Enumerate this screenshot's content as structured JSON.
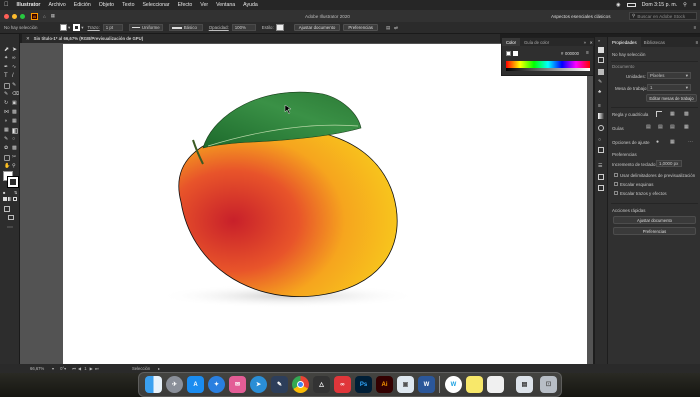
{
  "menubar": {
    "app_name": "Illustrator",
    "items": [
      "Archivo",
      "Edición",
      "Objeto",
      "Texto",
      "Seleccionar",
      "Efecto",
      "Ver",
      "Ventana",
      "Ayuda"
    ],
    "clock": "Dom 3:15 p. m."
  },
  "appbar": {
    "title": "Adobe Illustrator 2020",
    "workspace": "Aspectos esenciales clásicos",
    "search_placeholder": "Buscar en Adobe Stock"
  },
  "control": {
    "no_selection": "No hay selección",
    "stroke_label": "Trazo:",
    "stroke_value": "1 pt",
    "profile_label": "Uniforme",
    "brush_label": "Básico",
    "opacity_label": "Opacidad:",
    "opacity_value": "100%",
    "style_label": "Estilo:",
    "doc_setup_button": "Ajustar documento",
    "preferences_button": "Preferencias"
  },
  "document_tab": {
    "title": "Sin título-1* al 66,67% (RGB/Previsualización de GPU)"
  },
  "color_panel": {
    "tab_color": "Color",
    "tab_guide": "Guía de color",
    "hex_value": "000000"
  },
  "properties_panel": {
    "tab_properties": "Propiedades",
    "tab_libraries": "Bibliotecas",
    "no_selection": "No hay selección",
    "document_heading": "Documento",
    "units_label": "Unidades:",
    "units_value": "Píxeles",
    "artboard_label": "Mesa de trabajo:",
    "artboard_value": "1",
    "edit_artboards_button": "Editar mesas de trabajo",
    "ruler_grid_heading": "Regla y cuadrícula",
    "guides_heading": "Guías",
    "snap_options_heading": "Opciones de ajuste",
    "preferences_heading": "Preferencias",
    "keyboard_increment_label": "Incremento de teclado:",
    "keyboard_increment_value": "1,0000 px",
    "checkboxes": [
      "Usar delimitadores de previsualización",
      "Escalar esquinas",
      "Escalar trazos y efectos"
    ],
    "quick_actions_heading": "Acciones rápidas",
    "doc_setup_button": "Ajustar documento",
    "preferences_button": "Preferencias"
  },
  "statusbar": {
    "zoom": "66,67%",
    "rotation": "0°",
    "artboard_nav": "1",
    "tool_name": "Selección"
  },
  "dock": {
    "apps": [
      "Finder",
      "Launchpad",
      "App Store",
      "Safari",
      "Mail",
      "Telegram",
      "Chrome",
      "Affinity",
      "Photoshop",
      "Illustrator",
      "Photos",
      "Word",
      "Preview",
      "Notes",
      "Trash"
    ],
    "ps_label": "Ps",
    "ai_label": "Ai",
    "w_label": "W"
  },
  "colors": {
    "accent_orange": "#ff9a00",
    "panel_bg": "#303030",
    "mango_red": "#d8322a",
    "mango_yellow": "#f6c21a",
    "leaf_green": "#2f7d3a"
  }
}
